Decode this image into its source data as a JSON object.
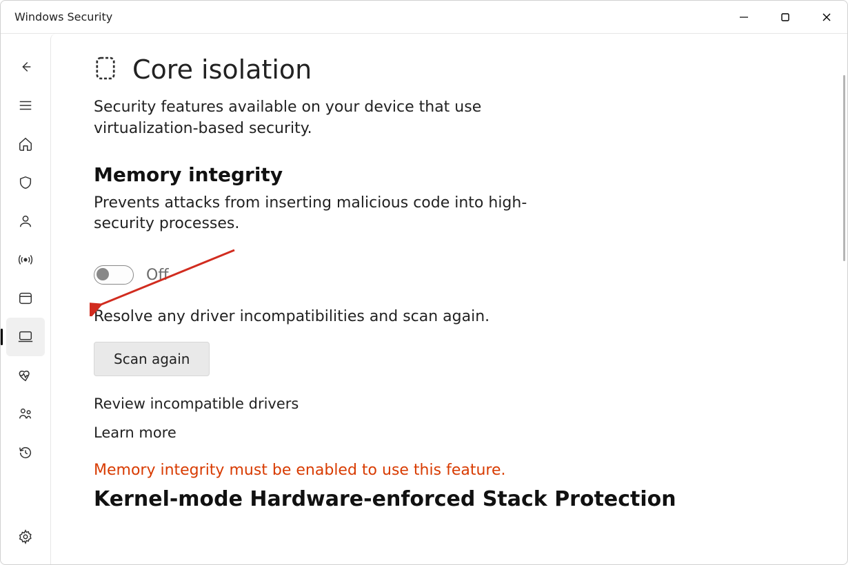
{
  "window": {
    "title": "Windows Security"
  },
  "page": {
    "title": "Core isolation",
    "subtitle": "Security features available on your device that use virtualization-based security."
  },
  "memory_integrity": {
    "heading": "Memory integrity",
    "description": "Prevents attacks from inserting malicious code into high-security processes.",
    "toggle_state": "Off",
    "resolve_note": "Resolve any driver incompatibilities and scan again.",
    "scan_button": "Scan again",
    "review_link": "Review incompatible drivers",
    "learn_link": "Learn more"
  },
  "kernel_section": {
    "warning": "Memory integrity must be enabled to use this feature.",
    "heading": "Kernel-mode Hardware-enforced Stack Protection"
  }
}
